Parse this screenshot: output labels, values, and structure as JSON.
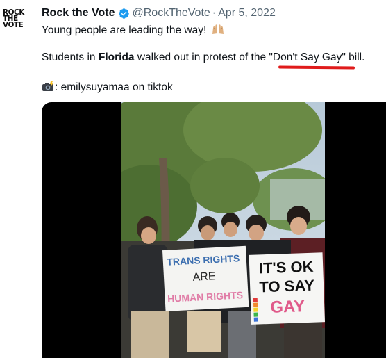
{
  "tweet": {
    "author_name": "Rock the Vote",
    "handle": "@RockTheVote",
    "separator": "·",
    "date": "Apr 5, 2022",
    "avatar_text": [
      "ROCK",
      "THE",
      "VOTE"
    ],
    "line1": "Young people are leading the way!",
    "line2_prefix": "Students in ",
    "line2_bold": "Florida",
    "line2_middle": " walked out in protest of the ",
    "line2_quoted": "\"Don't Say Gay\"",
    "line2_suffix": " bill.",
    "line3": ": emilysuyamaa on tiktok"
  },
  "media": {
    "sign_left_lines": [
      "TRANS RIGHTS",
      "ARE",
      "HUMAN RIGHTS"
    ],
    "sign_right_lines": [
      "IT'S OK",
      "TO SAY",
      "GAY"
    ]
  },
  "colors": {
    "verified": "#1d9bf0",
    "secondary_text": "#536471",
    "underline": "#e01b1b",
    "avatar_slash": "#d21f2a"
  },
  "icons": {
    "verified": "verified-badge-icon",
    "hands": "raising-hands-emoji",
    "camera": "camera-flash-emoji"
  }
}
